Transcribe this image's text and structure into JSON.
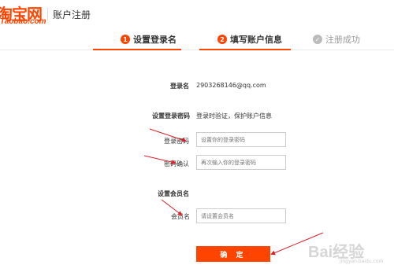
{
  "header": {
    "logo_cn": "淘宝网",
    "logo_en": "Taobao.com",
    "title": "账户注册"
  },
  "steps": [
    {
      "num": "1",
      "label": "设置登录名",
      "state": "done"
    },
    {
      "num": "2",
      "label": "填写账户信息",
      "state": "active"
    },
    {
      "num": "",
      "label": "注册成功",
      "state": "pending"
    }
  ],
  "form": {
    "login_name_label": "登录名",
    "login_name_value": "2903268146@qq.com",
    "password_section_title": "设置登录密码",
    "password_hint": "登录时验证，保护账户信息",
    "password_label": "登录密码",
    "password_placeholder": "设置你的登录密码",
    "confirm_label": "密码确认",
    "confirm_placeholder": "再次输入你的登录密码",
    "member_section_title": "设置会员名",
    "member_label": "会员名",
    "member_placeholder": "请设置会员名",
    "submit_label": "确 定"
  },
  "colors": {
    "accent": "#ff4400",
    "arrow": "#d8202a"
  },
  "watermark": {
    "text": "Bai经验",
    "sub": "jingyan.baidu.com"
  }
}
